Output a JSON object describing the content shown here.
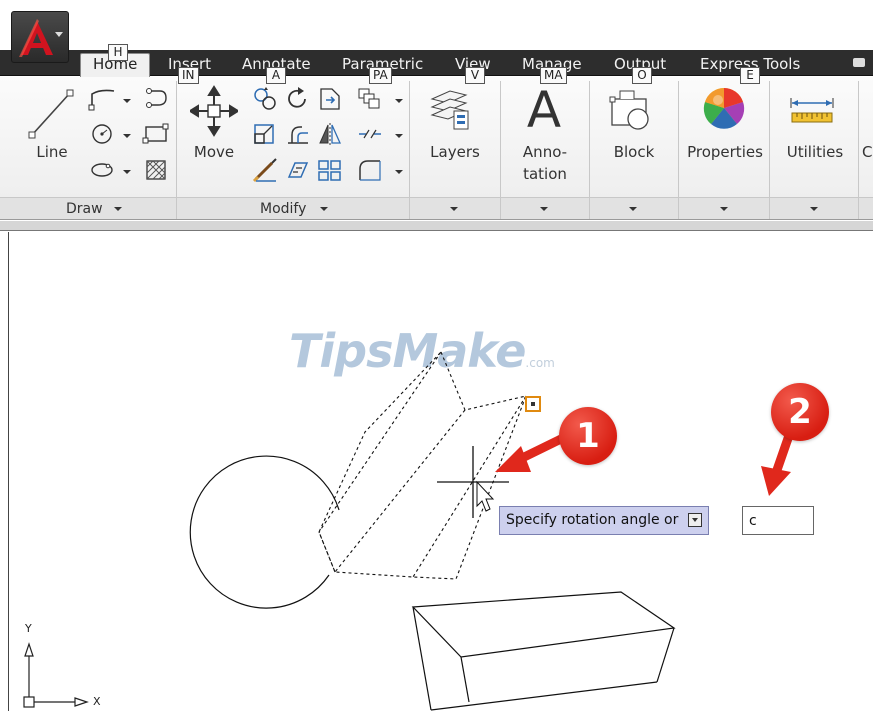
{
  "app": {
    "menu_icon": "autocad-logo-icon",
    "brand_color": "#c8102e"
  },
  "tabs": [
    {
      "label": "Home",
      "keytip": "H",
      "active": true
    },
    {
      "label": "Insert",
      "keytip": "IN"
    },
    {
      "label": "Annotate",
      "keytip": "A"
    },
    {
      "label": "Parametric",
      "keytip": "PA"
    },
    {
      "label": "View",
      "keytip": "V"
    },
    {
      "label": "Manage",
      "keytip": "MA"
    },
    {
      "label": "Output",
      "keytip": "O"
    },
    {
      "label": "Express Tools",
      "keytip": "E"
    }
  ],
  "ribbon": {
    "draw": {
      "panel_label": "Draw",
      "line_label": "Line",
      "tools": [
        "polyline-icon",
        "arc-icon",
        "circle-icon",
        "rectangle-icon",
        "ellipse-icon",
        "hatch-icon"
      ]
    },
    "modify": {
      "panel_label": "Modify",
      "move_label": "Move",
      "tools": [
        "rotate-icon",
        "trim-icon",
        "copy-icon",
        "mirror-icon",
        "fillet-icon",
        "stretch-icon",
        "scale-icon",
        "array-icon",
        "break-icon",
        "offset-icon",
        "explode-icon",
        "chamfer-icon"
      ]
    },
    "layers_label": "Layers",
    "annotation_label_1": "Anno-",
    "annotation_label_2": "tation",
    "block_label": "Block",
    "properties_label": "Properties",
    "utilities_label": "Utilities",
    "clipped_label": "C"
  },
  "canvas": {
    "watermark": "TipsMake",
    "watermark_suffix": ".com",
    "tooltip": "Specify rotation angle or",
    "command_value": "c",
    "badge_1": "1",
    "badge_2": "2",
    "ucs_y": "Y",
    "ucs_x": "X"
  },
  "colors": {
    "ribbon_dark": "#2d2d2d",
    "tooltip_bg": "#cdd0ee",
    "badge_red": "#e0281c",
    "grip_orange": "#e08a10",
    "watermark_blue": "#b4c8dd"
  }
}
